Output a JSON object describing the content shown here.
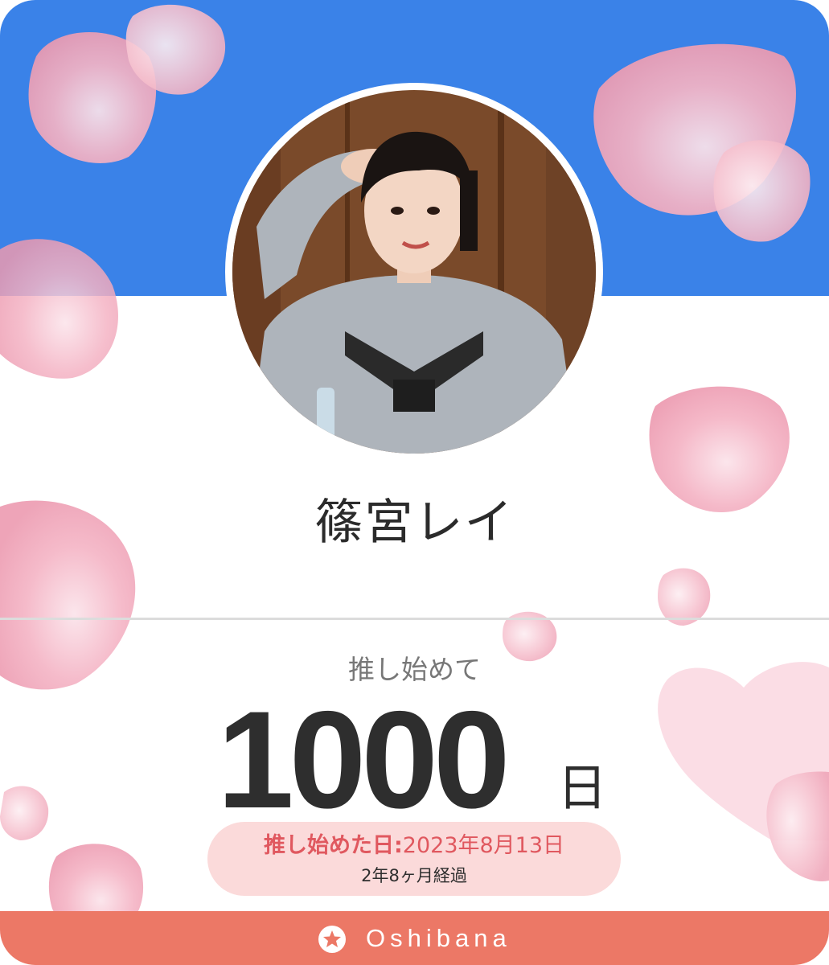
{
  "profile": {
    "name": "篠宮レイ",
    "photo_alt": "篠宮レイ"
  },
  "stats": {
    "since_label": "推し始めて",
    "days": "1000",
    "days_unit": "日",
    "start_label": "推し始めた日:",
    "start_date": "2023年8月13日",
    "elapsed": "2年8ヶ月経過"
  },
  "footer": {
    "brand": "Oshibana",
    "icon": "star-icon"
  },
  "colors": {
    "top_band": "#3a82e8",
    "footer": "#ec7866",
    "pill_bg": "#fbdada",
    "accent_text": "#e0585f",
    "petal": "#f4b3c4"
  }
}
